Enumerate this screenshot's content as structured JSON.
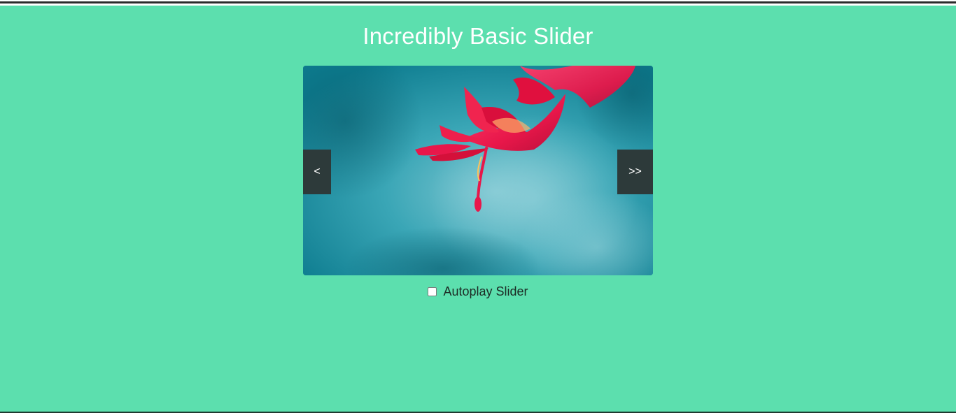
{
  "page": {
    "title": "Incredibly Basic Slider"
  },
  "slider": {
    "slide_image": "red flower on teal background",
    "prev_label": "<",
    "next_label": ">>"
  },
  "autoplay": {
    "label": "Autoplay Slider",
    "checked": false
  },
  "colors": {
    "background": "#5cdfae",
    "nav_button": "#2d3a3a",
    "text": "#ffffff"
  }
}
